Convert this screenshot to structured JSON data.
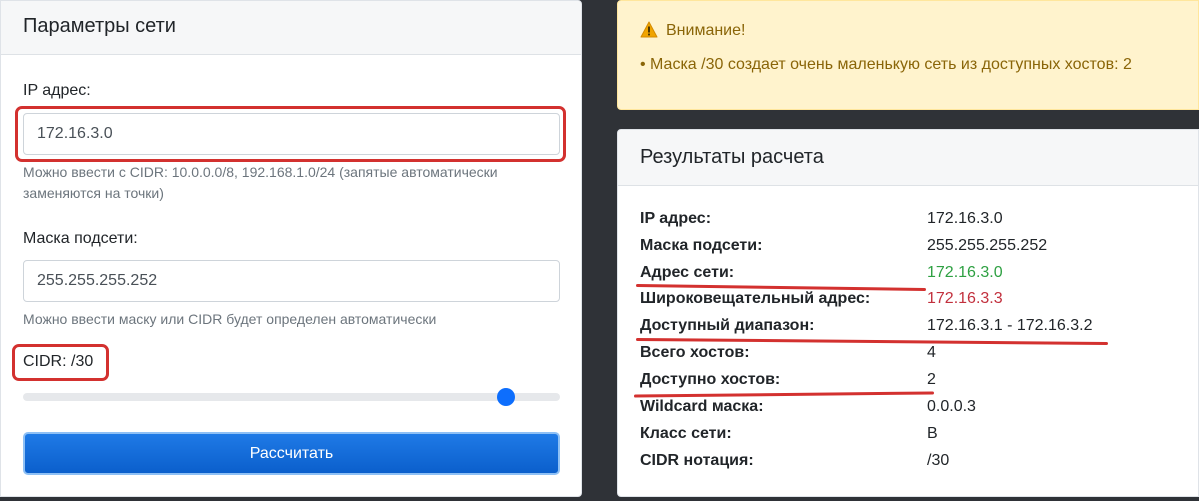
{
  "params": {
    "title": "Параметры сети",
    "ip_label": "IP адрес:",
    "ip_value": "172.16.3.0",
    "ip_hint": "Можно ввести с CIDR: 10.0.0.0/8, 192.168.1.0/24 (запятые автоматически заменяются на точки)",
    "mask_label": "Маска подсети:",
    "mask_value": "255.255.255.252",
    "mask_hint": "Можно ввести маску или CIDR будет определен автоматически",
    "cidr_label": "CIDR: /30",
    "cidr_slider": {
      "value": 30,
      "min": 0,
      "max": 32
    },
    "calc_button": "Рассчитать"
  },
  "warning": {
    "title": "Внимание!",
    "message": "• Маска /30 создает очень маленькую сеть из доступных хостов: 2",
    "icon": "warning-triangle-icon"
  },
  "results": {
    "title": "Результаты расчета",
    "rows": [
      {
        "key": "IP адрес:",
        "value": "172.16.3.0"
      },
      {
        "key": "Маска подсети:",
        "value": "255.255.255.252"
      },
      {
        "key": "Адрес сети:",
        "value": "172.16.3.0"
      },
      {
        "key": "Широковещательный адрес:",
        "value": "172.16.3.3"
      },
      {
        "key": "Доступный диапазон:",
        "value": "172.16.3.1 - 172.16.3.2"
      },
      {
        "key": "Всего хостов:",
        "value": "4"
      },
      {
        "key": "Доступно хостов:",
        "value": "2"
      },
      {
        "key": "Wildcard маска:",
        "value": "0.0.0.3"
      },
      {
        "key": "Класс сети:",
        "value": "B"
      },
      {
        "key": "CIDR нотация:",
        "value": "/30"
      }
    ]
  },
  "colors": {
    "primary": "#0d6efd",
    "network_address": "#2ea042",
    "broadcast_address": "#c2303d",
    "annotation": "#d3312f",
    "warning_bg": "#fff3cd"
  }
}
